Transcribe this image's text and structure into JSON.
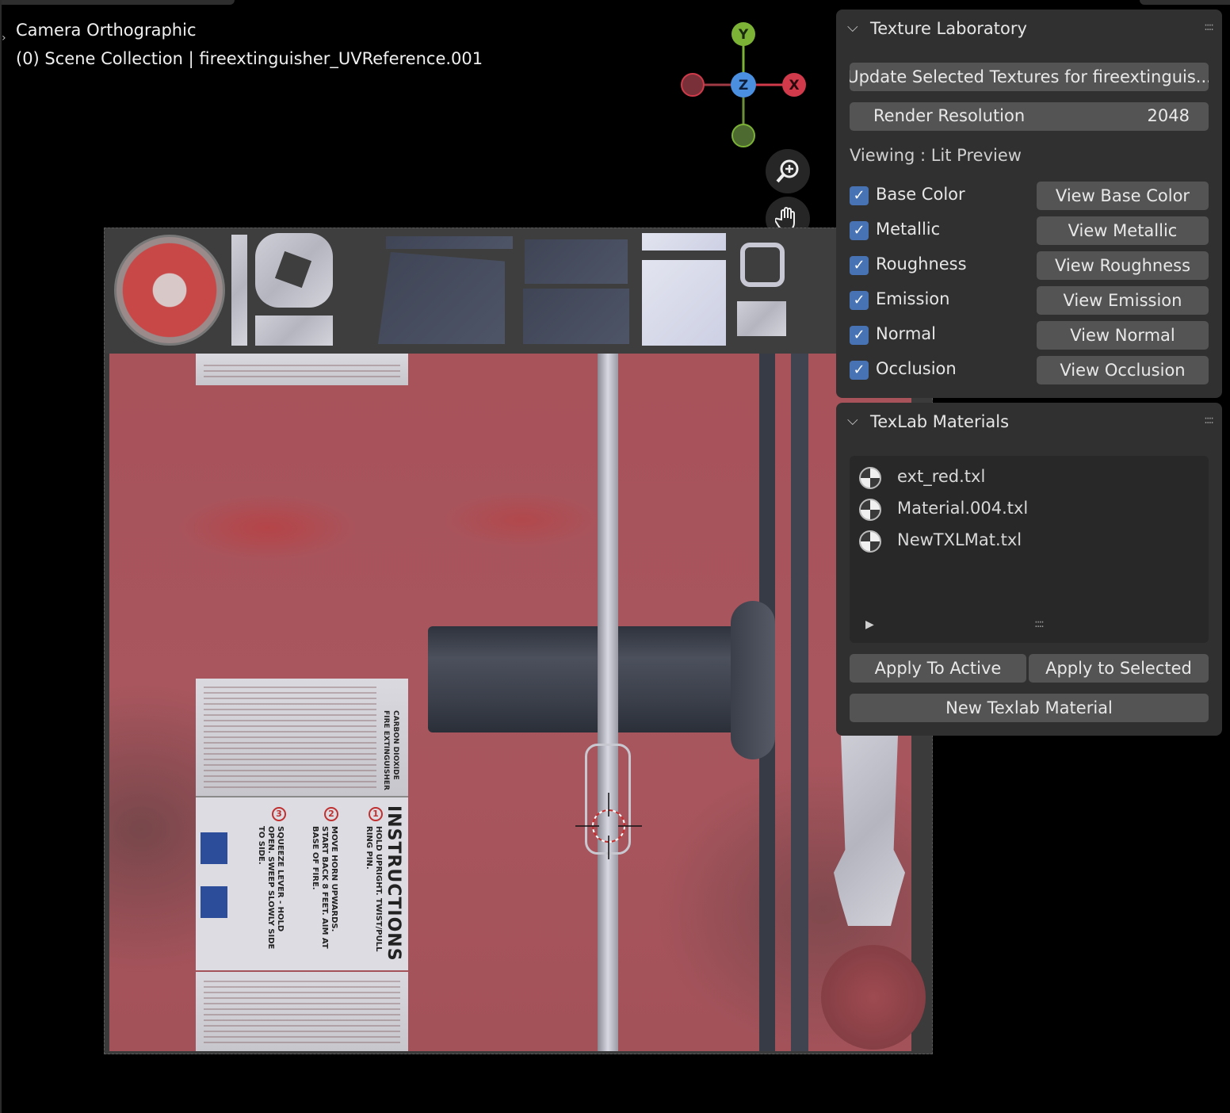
{
  "viewport": {
    "line1": "Camera Orthographic",
    "line2": "(0) Scene Collection | fireextinguisher_UVReference.001"
  },
  "gizmo": {
    "y": "Y",
    "z": "Z",
    "x": "X"
  },
  "icons": {
    "zoom": "zoom-icon",
    "pan": "hand-icon",
    "camera": "camera-icon",
    "lock": "lock-icon"
  },
  "uv_label": {
    "instructions_title": "INSTRUCTIONS",
    "step1": "HOLD UPRIGHT. TWIST/PULL RING PIN.",
    "step2": "MOVE HORN UPWARDS. START BACK 8 FEET. AIM AT BASE OF FIRE.",
    "step3": "SQUEEZE LEVER - HOLD OPEN. SWEEP SLOWLY SIDE TO SIDE.",
    "carbon": "CARBON DIOXIDE FIRE EXTINGUISHER"
  },
  "texture_lab": {
    "title": "Texture Laboratory",
    "update_button": "Update Selected Textures for fireextinguis...",
    "render_resolution_label": "Render Resolution",
    "render_resolution_value": "2048",
    "viewing": "Viewing : Lit Preview",
    "channels": [
      {
        "label": "Base Color",
        "button": "View Base Color",
        "checked": true
      },
      {
        "label": "Metallic",
        "button": "View Metallic",
        "checked": true
      },
      {
        "label": "Roughness",
        "button": "View Roughness",
        "checked": true
      },
      {
        "label": "Emission",
        "button": "View Emission",
        "checked": true
      },
      {
        "label": "Normal",
        "button": "View Normal",
        "checked": true
      },
      {
        "label": "Occlusion",
        "button": "View Occlusion",
        "checked": true
      }
    ]
  },
  "materials": {
    "title": "TexLab Materials",
    "items": [
      "ext_red.txl",
      "Material.004.txl",
      "NewTXLMat.txl"
    ],
    "apply_active": "Apply To Active",
    "apply_selected": "Apply to Selected",
    "new_material": "New Texlab Material"
  },
  "colors": {
    "panel_bg": "#303030",
    "button_bg": "#545454",
    "checkbox": "#4772b3",
    "axis_x": "#d13a4a",
    "axis_y": "#7cb336",
    "axis_z": "#4a8fe0"
  }
}
